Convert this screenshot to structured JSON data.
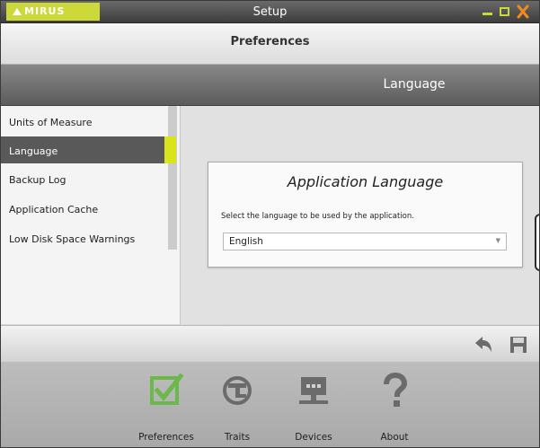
{
  "window": {
    "logo_text": "MIRUS",
    "title": "Setup"
  },
  "header": {
    "section_title": "Preferences",
    "page_title": "Language"
  },
  "sidebar": {
    "items": [
      {
        "label": "Units of Measure",
        "active": false
      },
      {
        "label": "Language",
        "active": true
      },
      {
        "label": "Backup Log",
        "active": false
      },
      {
        "label": "Application Cache",
        "active": false
      },
      {
        "label": "Low Disk Space Warnings",
        "active": false
      }
    ]
  },
  "main": {
    "card_title": "Application Language",
    "description": "Select the language to be used by the application.",
    "language_select": {
      "selected": "English"
    }
  },
  "actions": {
    "icons": [
      "undo-icon",
      "save-icon"
    ]
  },
  "bottom_nav": {
    "items": [
      {
        "label": "Preferences",
        "icon": "checkbox-icon"
      },
      {
        "label": "Traits",
        "icon": "traits-icon"
      },
      {
        "label": "Devices",
        "icon": "devices-icon"
      },
      {
        "label": "About",
        "icon": "question-icon"
      }
    ]
  },
  "colors": {
    "accent": "#d8e51d",
    "active_nav": "#6ab94a",
    "close": "#f08a1d"
  }
}
